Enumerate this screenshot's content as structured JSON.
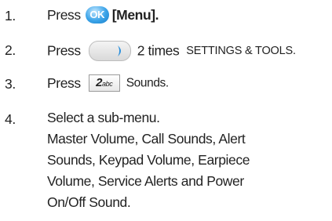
{
  "steps": [
    {
      "number": "1.",
      "press": "Press",
      "key_label": "OK",
      "suffix": "[Menu]."
    },
    {
      "number": "2.",
      "press": "Press",
      "suffix": "2 times",
      "menu": "SETTINGS & TOOLS."
    },
    {
      "number": "3.",
      "press": "Press",
      "key_digit": "2",
      "key_letters": "abc",
      "suffix": "Sounds."
    },
    {
      "number": "4.",
      "text": "Select a sub-menu.",
      "lines": [
        "Master Volume, Call Sounds, Alert",
        "Sounds, Keypad Volume, Earpiece",
        "Volume, Service Alerts and Power",
        "On/Off Sound."
      ]
    }
  ],
  "colors": {
    "text": "#222222",
    "ok_key": "#3aa3e8",
    "nav_arrow": "#2a8fdc"
  },
  "icons": {
    "ok": "ok-key-icon",
    "nav": "nav-right-key-icon",
    "num": "number-2-key-icon"
  }
}
